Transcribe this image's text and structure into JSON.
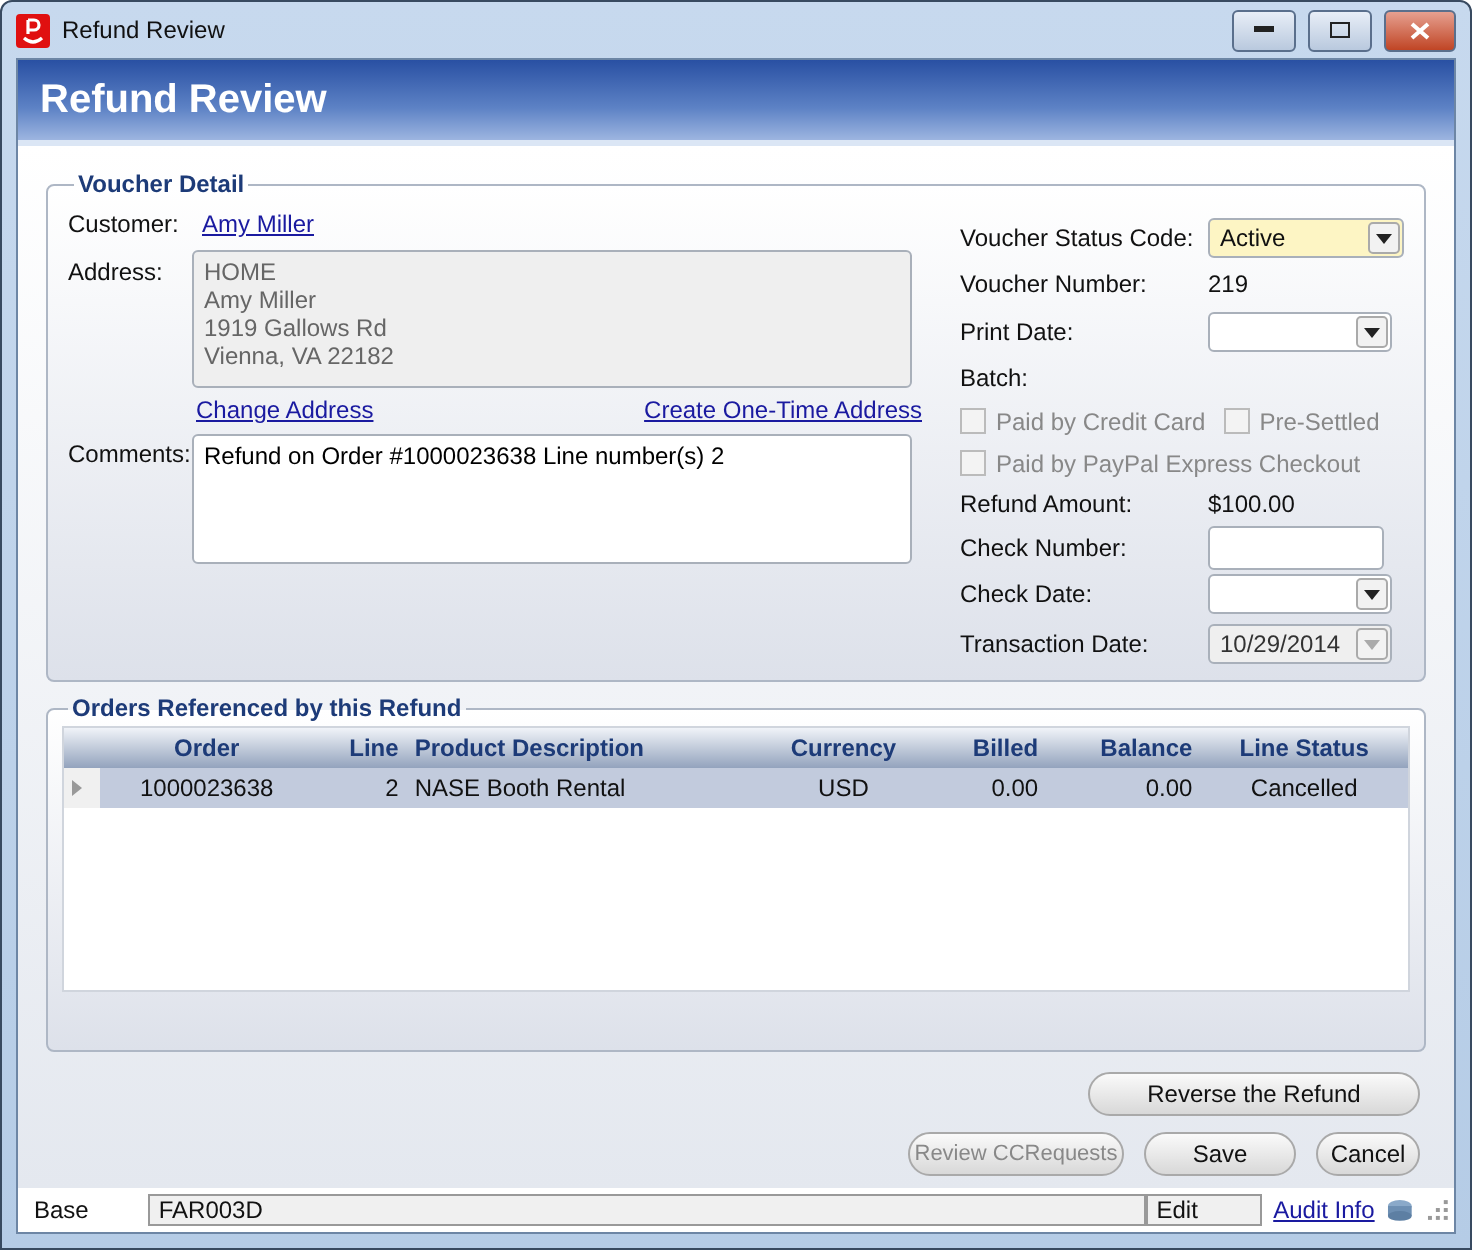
{
  "window": {
    "title": "Refund Review"
  },
  "header": {
    "title": "Refund Review"
  },
  "voucher_detail": {
    "legend": "Voucher Detail",
    "customer": {
      "label": "Customer:",
      "value": "Amy Miller"
    },
    "address": {
      "label": "Address:",
      "lines": [
        "HOME",
        "Amy Miller",
        "1919 Gallows Rd",
        "Vienna, VA 22182"
      ]
    },
    "links": [
      "Change Address",
      "Create One-Time Address"
    ],
    "comments": {
      "label": "Comments:",
      "value": "Refund on Order #1000023638 Line number(s) 2"
    },
    "fields": [
      {
        "kind": "dropdown",
        "label": "Voucher Status Code:",
        "value": "Active",
        "required": true,
        "disabled": false
      },
      {
        "kind": "value",
        "label": "Voucher Number:",
        "value": "219"
      },
      {
        "kind": "dropdown",
        "label": "Print Date:",
        "required": false,
        "disabled": false
      },
      {
        "kind": "value",
        "label": "Batch:"
      },
      {
        "kind": "checkboxes",
        "items": [
          {
            "label": "Paid by Credit Card",
            "checked": false,
            "disabled": true
          },
          {
            "label": "Pre-Settled",
            "checked": false,
            "disabled": true
          }
        ]
      },
      {
        "kind": "checkboxes",
        "items": [
          {
            "label": "Paid by PayPal Express Checkout",
            "checked": false,
            "disabled": true
          }
        ]
      },
      {
        "kind": "value",
        "label": "Refund Amount:",
        "value": "$100.00"
      },
      {
        "kind": "input",
        "label": "Check Number:"
      },
      {
        "kind": "dropdown",
        "label": "Check Date:",
        "required": false,
        "disabled": false
      },
      {
        "kind": "dropdown",
        "label": "Transaction Date:",
        "value": "10/29/2014",
        "required": false,
        "disabled": true
      }
    ]
  },
  "orders": {
    "legend": "Orders Referenced by this Refund",
    "columns": [
      "Order",
      "Line",
      "Product Description",
      "Currency",
      "Billed",
      "Balance",
      "Line Status"
    ],
    "rows": [
      {
        "cells": [
          "1000023638",
          "2",
          "NASE Booth Rental",
          "USD",
          "0.00",
          "0.00",
          "Cancelled"
        ],
        "selected": true
      }
    ]
  },
  "buttons": [
    {
      "label": "Reverse the Refund",
      "disabled": false
    }
  ],
  "footer_buttons": [
    {
      "label": "Review CCRequests",
      "disabled": true
    },
    {
      "label": "Save",
      "disabled": false
    },
    {
      "label": "Cancel",
      "disabled": false
    }
  ],
  "status_bar": {
    "label": "Base",
    "code": "FAR003D",
    "mode": "Edit",
    "link": "Audit Info"
  }
}
